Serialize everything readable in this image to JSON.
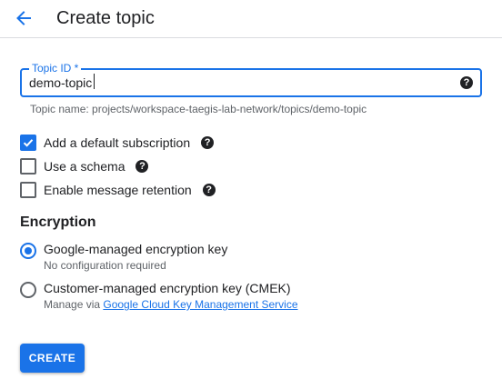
{
  "header": {
    "back_icon": "arrow-back-icon",
    "title": "Create topic"
  },
  "topic_id": {
    "label": "Topic ID *",
    "value": "demo-topic",
    "help_icon": "help-circle-icon",
    "help_glyph": "?",
    "hint": "Topic name: projects/workspace-taegis-lab-network/topics/demo-topic"
  },
  "options": [
    {
      "label": "Add a default subscription",
      "checked": true,
      "help_glyph": "?"
    },
    {
      "label": "Use a schema",
      "checked": false,
      "help_glyph": "?"
    },
    {
      "label": "Enable message retention",
      "checked": false,
      "help_glyph": "?"
    }
  ],
  "encryption": {
    "title": "Encryption",
    "options": [
      {
        "label": "Google-managed encryption key",
        "sub": "No configuration required",
        "selected": true
      },
      {
        "label": "Customer-managed encryption key (CMEK)",
        "sub_prefix": "Manage via ",
        "sub_link": "Google Cloud Key Management Service",
        "selected": false
      }
    ]
  },
  "actions": {
    "create_label": "CREATE"
  },
  "colors": {
    "accent": "#1a73e8",
    "text": "#202124",
    "secondary_text": "#5f6368",
    "divider": "#dadce0"
  }
}
